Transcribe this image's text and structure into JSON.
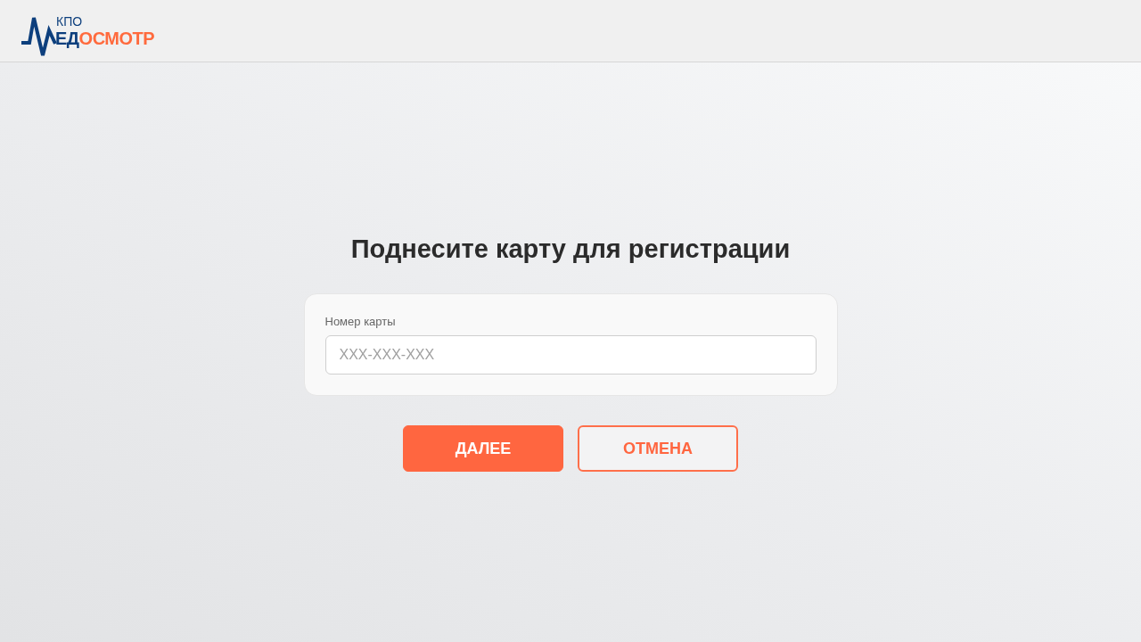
{
  "logo": {
    "caption": "КПО",
    "wordmark_dark": "ЕД",
    "wordmark_accent": "ОСМОТР"
  },
  "title": "Поднесите карту для регистрации",
  "form": {
    "label": "Номер карты",
    "placeholder": "XXX-XXX-XXX"
  },
  "buttons": [
    {
      "label": "ДАЛЕЕ",
      "kind": "primary"
    },
    {
      "label": "ОТМЕНА",
      "kind": "secondary"
    }
  ]
}
